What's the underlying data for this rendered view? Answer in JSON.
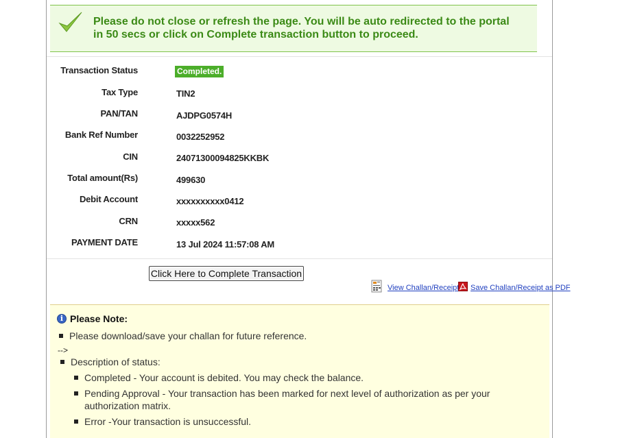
{
  "banner": {
    "message": "Please do not close or refresh the page. You will be auto redirected to the portal in 50 secs or click on Complete transaction button to proceed."
  },
  "transaction": {
    "rows": [
      {
        "label": "Transaction Status",
        "value": "Completed."
      },
      {
        "label": "Tax Type",
        "value": "TIN2"
      },
      {
        "label": "PAN/TAN",
        "value": "AJDPG0574H"
      },
      {
        "label": "Bank Ref Number",
        "value": "0032252952"
      },
      {
        "label": "CIN",
        "value": "24071300094825KKBK"
      },
      {
        "label": "Total amount(Rs)",
        "value": "499630"
      },
      {
        "label": "Debit Account",
        "value": "xxxxxxxxxx0412"
      },
      {
        "label": "CRN",
        "value": "xxxxx562"
      },
      {
        "label": "PAYMENT DATE",
        "value": "13 Jul 2024 11:57:08 AM"
      }
    ]
  },
  "actions": {
    "complete_button": "Click Here to Complete Transaction",
    "view_challan": "View Challan/Receipt",
    "save_pdf": "Save Challan/Receipt as PDF"
  },
  "note": {
    "title": "Please Note:",
    "item1": "Please download/save your challan for future reference.",
    "arrow": "-->",
    "item2": "Description of status:",
    "sub": [
      "Completed - Your account is debited. You may check the balance.",
      "Pending Approval - Your transaction has been marked for next level of authorization as per your authorization matrix.",
      "Error -Your transaction is unsuccessful."
    ]
  },
  "colors": {
    "success_green": "#4cae2a",
    "banner_text": "#3b8a16",
    "link_blue": "#1f3fbf",
    "note_bg": "#ffffe0"
  },
  "icons": {
    "banner": "checkmark-icon",
    "view": "receipt-icon",
    "pdf": "pdf-icon",
    "note": "info-icon"
  }
}
